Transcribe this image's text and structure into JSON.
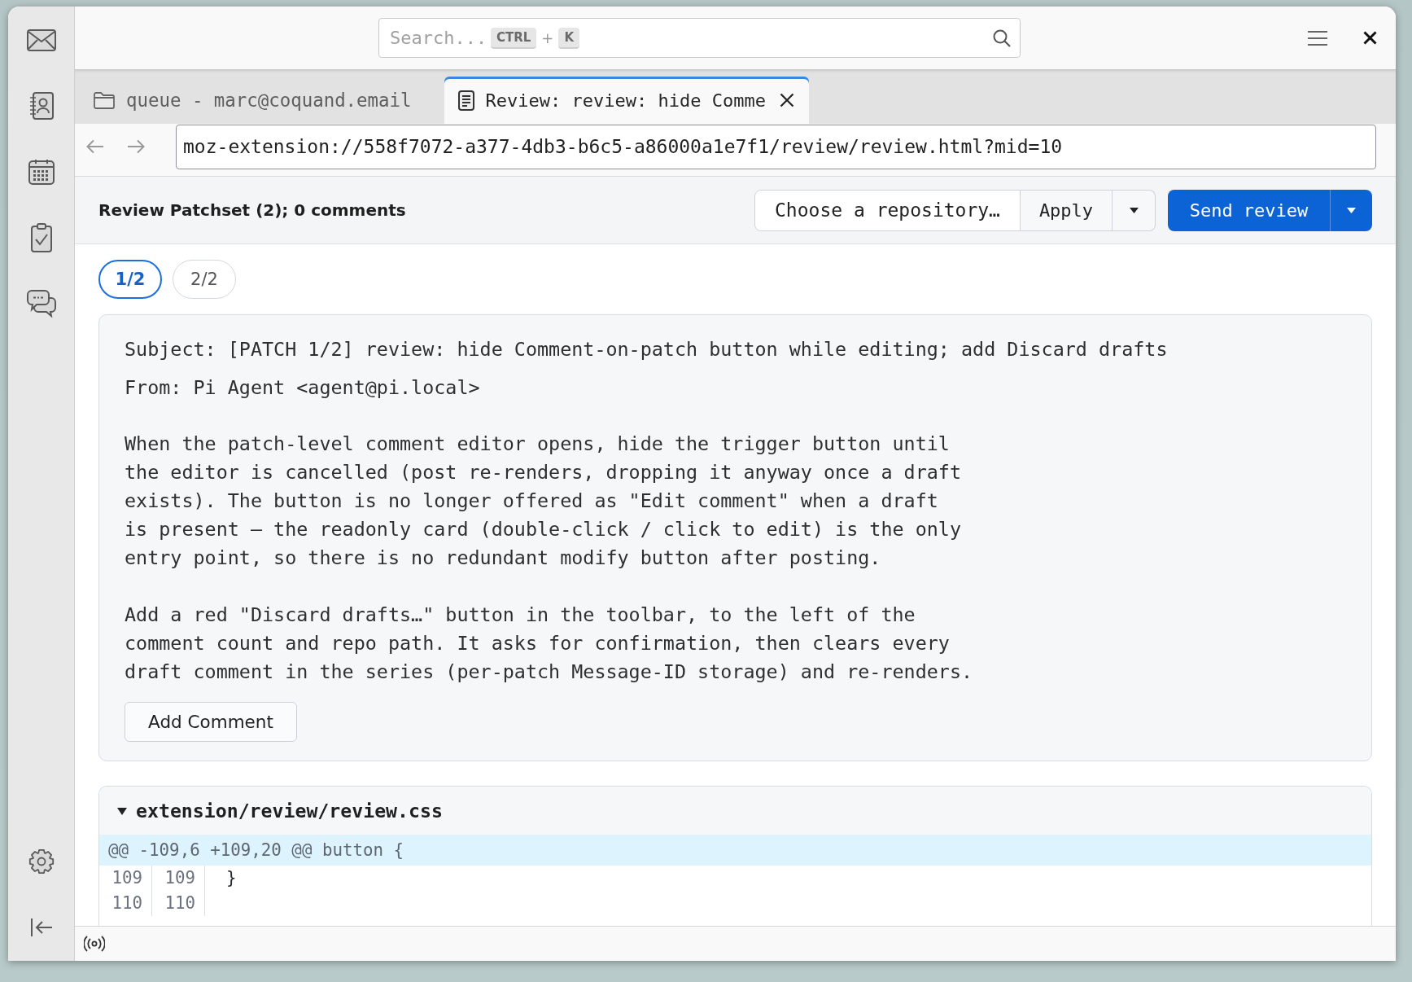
{
  "search": {
    "placeholder": "Search...",
    "shortcut_keys": [
      "CTRL",
      "K"
    ],
    "shortcut_separator": "+"
  },
  "tabs": [
    {
      "kind": "folder",
      "label": "queue - marc@coquand.email",
      "selected": false
    },
    {
      "kind": "content",
      "label": "Review: review: hide Comme",
      "selected": true
    }
  ],
  "address_bar": {
    "url": "moz-extension://558f7072-a377-4db3-b6c5-a86000a1e7f1/review/review.html?mid=10"
  },
  "review_header": {
    "title": "Review Patchset (2); 0 comments",
    "repository_select": "Choose a repository…",
    "apply_button": "Apply",
    "send_button": "Send review"
  },
  "patches": [
    {
      "label": "1/2",
      "selected": true
    },
    {
      "label": "2/2",
      "selected": false
    }
  ],
  "message": {
    "subject": "Subject: [PATCH 1/2] review: hide Comment-on-patch button while editing; add Discard drafts",
    "from": "From: Pi Agent <agent@pi.local>",
    "paragraphs": [
      "When the patch-level comment editor opens, hide the trigger button until\nthe editor is cancelled (post re-renders, dropping it anyway once a draft\nexists). The button is no longer offered as \"Edit comment\" when a draft\nis present — the readonly card (double-click / click to edit) is the only\nentry point, so there is no redundant modify button after posting.",
      "Add a red \"Discard drafts…\" button in the toolbar, to the left of the\ncomment count and repo path. It asks for confirmation, then clears every\ndraft comment in the series (per-patch Message-ID storage) and re-renders."
    ],
    "add_comment_button": "Add Comment"
  },
  "files": [
    {
      "path": "extension/review/review.css",
      "expanded": true,
      "hunks": [
        {
          "header": "@@ -109,6 +109,20 @@ button {",
          "lines": [
            {
              "kind": "context",
              "old": "109",
              "new": "109",
              "text": "}"
            },
            {
              "kind": "context",
              "old": "110",
              "new": "110"
            }
          ]
        }
      ]
    }
  ]
}
